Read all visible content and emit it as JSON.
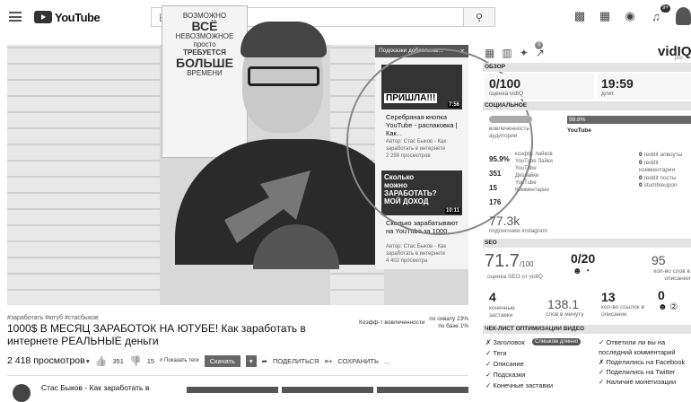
{
  "header": {
    "search_placeholder": "Введите запрос",
    "logo_text": "YouTube",
    "notif_count": "9+"
  },
  "video": {
    "poster_lines": [
      "ВОЗМОЖНО",
      "ВСЁ",
      "НЕВОЗМОЖНОЕ",
      "просто",
      "ТРЕБУЕТСЯ",
      "БОЛЬШЕ",
      "ВРЕМЕНИ"
    ],
    "hints_title": "Подсказки добавлены...",
    "hints": [
      {
        "thumb_text": "ПРИШЛА!!!",
        "duration": "7:56",
        "title": "Серебряная кнопка YouTube - распаковка | Как...",
        "author": "Автор: Стас Быков - Как заработать в интернете",
        "views": "2 299 просмотров"
      },
      {
        "thumb_text": "Сколько можно ЗАРАБОТАТЬ? МОЙ ДОХОД",
        "duration": "10:11",
        "title": "Сколько зарабатывают на YouTube за 1000...",
        "author": "Автор: Стас Быков - Как заработать в интернете",
        "views": "4 402 просмотра"
      }
    ]
  },
  "below": {
    "tags": "#заработать #ютуб #стасбыков",
    "title": "1000$ В МЕСЯЦ ЗАРАБОТОК НА ЮТУБЕ! Как заработать в интернете РЕАЛЬНЫЕ деньги",
    "engagement_label": "Коэфф-т вовлеченности",
    "engagement_lines": [
      "по охвату 23%",
      "по базе 1%"
    ],
    "views": "2 418 просмотров",
    "likes": "351",
    "dislikes": "15",
    "show_tags": "# Показать теги",
    "download": "Скачать",
    "share": "ПОДЕЛИТЬСЯ",
    "save": "СОХРАНИТЬ",
    "more": "...",
    "channel": "Стас Быков - Как заработать в"
  },
  "sidebar": {
    "logo": "vidIQ",
    "logo_sub": "pro",
    "badge": "9",
    "overview": {
      "header": "ОБЗОР",
      "score": "0/100",
      "score_label": "оценка vidIQ",
      "time": "19:59",
      "time_label": "длит."
    },
    "social": {
      "header": "СОЦИАЛЬНОЕ",
      "engaged": "вовлеченность",
      "audience": "аудитории",
      "pct": "99.8%",
      "channel_name": "YouTube",
      "rows": [
        {
          "val": "95.9%",
          "label": "коэфф. лайков"
        },
        {
          "val": "351",
          "label": "YouTube Лайки"
        },
        {
          "val": "15",
          "label": "YouTube Дизлайки"
        },
        {
          "val": "176",
          "label": "YouTube Комментарии"
        }
      ],
      "reddit": [
        {
          "val": "0",
          "label": "reddit апвоуты"
        },
        {
          "val": "0",
          "label": "reddit комментарии"
        },
        {
          "val": "0",
          "label": "reddit посты"
        },
        {
          "val": "0",
          "label": "stumbleupon"
        }
      ],
      "insta": "77.3k",
      "insta_label": "подписчики instagram"
    },
    "seo": {
      "header": "SEO",
      "score": "71.7",
      "score_suffix": "/100",
      "score_label": "оценка SEO от vidIQ",
      "zero": "0/20",
      "kw": "95",
      "kw_label": "кол-во слов в описании",
      "n4": "4",
      "n4_label": "конечные заставки",
      "n138": "138.1",
      "n138_label": "слов в минуту",
      "n13": "13",
      "n13_label": "кол-во ссылок в описании",
      "n0": "0"
    },
    "checklist": {
      "header": "ЧЕК-ЛИСТ ОПТИМИЗАЦИИ ВИДЕО",
      "left": [
        "✗ Заголовок",
        "✓ Теги",
        "✓ Описание",
        "✓ Подсказки",
        "✓ Конечные заставки"
      ],
      "badge": "Слишком длинно",
      "right": [
        "✓ Ответили ли вы на последний комментарий",
        "✗ Поделились на Facebook",
        "✓ Поделились на Twitter",
        "✓ Наличие монетизации"
      ]
    }
  }
}
